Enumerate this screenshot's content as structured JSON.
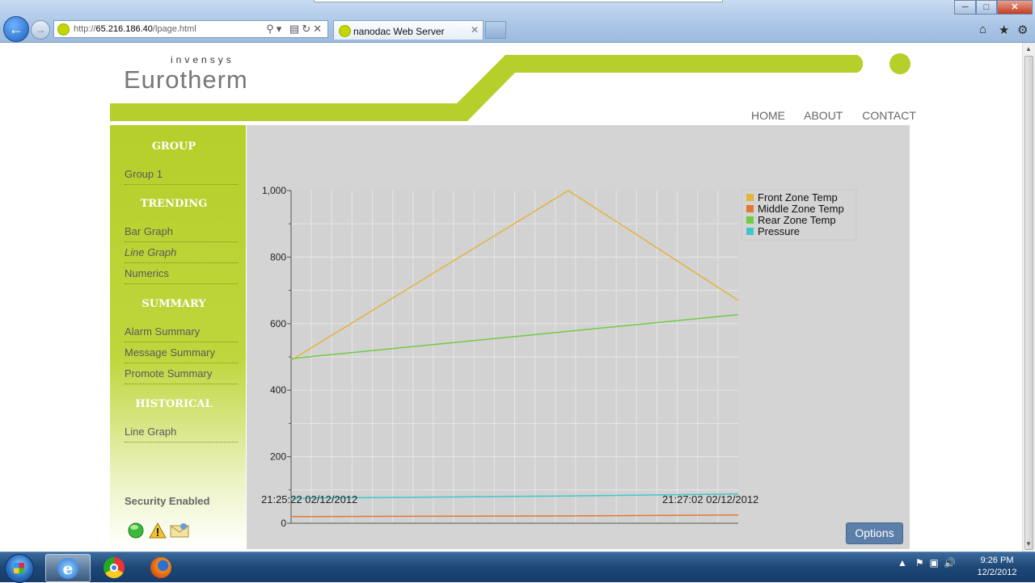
{
  "browser": {
    "address_url_prefix": "http://",
    "address_url_host": "65.216.186.40",
    "address_url_path": "/lpage.html",
    "tab_title": "nanodac Web Server"
  },
  "site": {
    "brand_sub": "invensys",
    "brand": "Eurotherm",
    "nav": [
      "HOME",
      "ABOUT",
      "CONTACT"
    ],
    "accent_color": "#b6cf2a"
  },
  "sidebar": {
    "sections": [
      {
        "heading": "GROUP",
        "items": [
          "Group 1"
        ]
      },
      {
        "heading": "TRENDING",
        "items": [
          "Bar Graph",
          "Line Graph",
          "Numerics"
        ]
      },
      {
        "heading": "SUMMARY",
        "items": [
          "Alarm Summary",
          "Message Summary",
          "Promote Summary"
        ]
      },
      {
        "heading": "HISTORICAL",
        "items": [
          "Line Graph"
        ]
      }
    ],
    "active_item": "Line Graph",
    "security_label": "Security Enabled",
    "security_icons": [
      "status-ok-icon",
      "alarm-warning-icon",
      "message-envelope-icon"
    ]
  },
  "chart_data": {
    "type": "line",
    "x_start_label": "21:25:22 02/12/2012",
    "x_end_label": "21:27:02 02/12/2012",
    "ylim": [
      0,
      1000
    ],
    "yticks": [
      "0",
      "200",
      "400",
      "600",
      "800",
      "1,000"
    ],
    "grid": true,
    "legend_position": "top-right",
    "x": [
      0,
      0.62,
      1
    ],
    "series": [
      {
        "name": "Front Zone Temp",
        "color": "#e3b53a",
        "values": [
          490,
          1000,
          670
        ]
      },
      {
        "name": "Middle Zone Temp",
        "color": "#e0783a",
        "values": [
          20,
          22,
          25
        ]
      },
      {
        "name": "Rear Zone Temp",
        "color": "#6fcc44",
        "values": [
          495,
          577,
          627
        ]
      },
      {
        "name": "Pressure",
        "color": "#3fc8cc",
        "values": [
          75,
          82,
          88
        ]
      }
    ]
  },
  "options_label": "Options",
  "taskbar": {
    "time": "9:26 PM",
    "date": "12/2/2012"
  }
}
